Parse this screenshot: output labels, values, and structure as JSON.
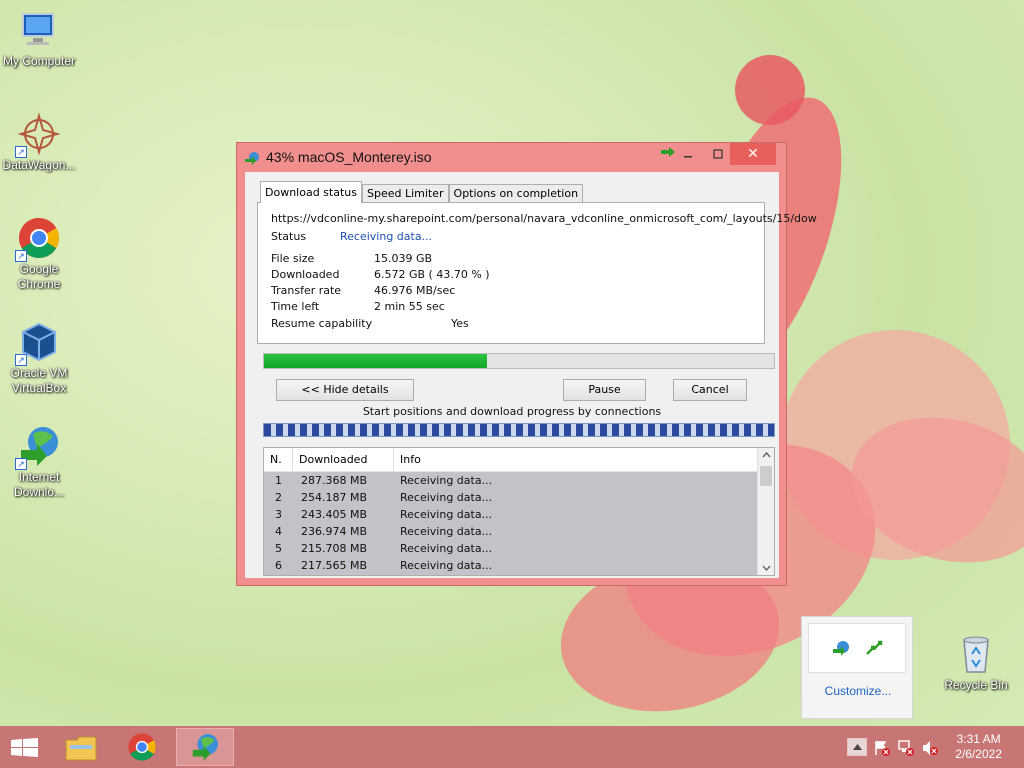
{
  "desktop": {
    "icons": [
      {
        "label": "My Computer",
        "icon": "computer-icon"
      },
      {
        "label": "DataWagon...",
        "icon": "datawagon-icon"
      },
      {
        "label": "Google Chrome",
        "icon": "chrome-icon"
      },
      {
        "label": "Oracle VM VirtualBox",
        "icon": "virtualbox-icon"
      },
      {
        "label": "Internet Downlo...",
        "icon": "idm-icon"
      },
      {
        "label": "Recycle Bin",
        "icon": "recycle-bin-icon"
      }
    ]
  },
  "window": {
    "title": "43% macOS_Monterey.iso",
    "close_glyph": "✕",
    "tabs": [
      "Download status",
      "Speed Limiter",
      "Options on completion"
    ],
    "url": "https://vdconline-my.sharepoint.com/personal/navara_vdconline_onmicrosoft_com/_layouts/15/dow",
    "status_label": "Status",
    "status_value": "Receiving data...",
    "file_size_label": "File size",
    "file_size_value": "15.039  GB",
    "downloaded_label": "Downloaded",
    "downloaded_value": "6.572  GB  ( 43.70 % )",
    "transfer_rate_label": "Transfer rate",
    "transfer_rate_value": "46.976  MB/sec",
    "time_left_label": "Time left",
    "time_left_value": "2 min 55 sec",
    "resume_label": "Resume capability",
    "resume_value": "Yes",
    "progress_fraction": 0.437,
    "hide_details_label": "<< Hide details",
    "pause_label": "Pause",
    "cancel_label": "Cancel",
    "connections_label": "Start positions and download progress by connections",
    "list_headers": [
      "N.",
      "Downloaded",
      "Info"
    ],
    "connections": [
      {
        "n": "1",
        "downloaded": "287.368  MB",
        "info": "Receiving data..."
      },
      {
        "n": "2",
        "downloaded": "254.187  MB",
        "info": "Receiving data..."
      },
      {
        "n": "3",
        "downloaded": "243.405  MB",
        "info": "Receiving data..."
      },
      {
        "n": "4",
        "downloaded": "236.974  MB",
        "info": "Receiving data..."
      },
      {
        "n": "5",
        "downloaded": "215.708  MB",
        "info": "Receiving data..."
      },
      {
        "n": "6",
        "downloaded": "217.565  MB",
        "info": "Receiving data..."
      }
    ]
  },
  "tray_popup": {
    "customize_label": "Customize..."
  },
  "taskbar": {
    "time": "3:31 AM",
    "date": "2/6/2022"
  },
  "colors": {
    "window_frame": "#f18f8f",
    "close_button": "#e8605c",
    "progress_fill": "#1fb535",
    "status_text": "#1f4eb0",
    "taskbar": "#c87575"
  }
}
